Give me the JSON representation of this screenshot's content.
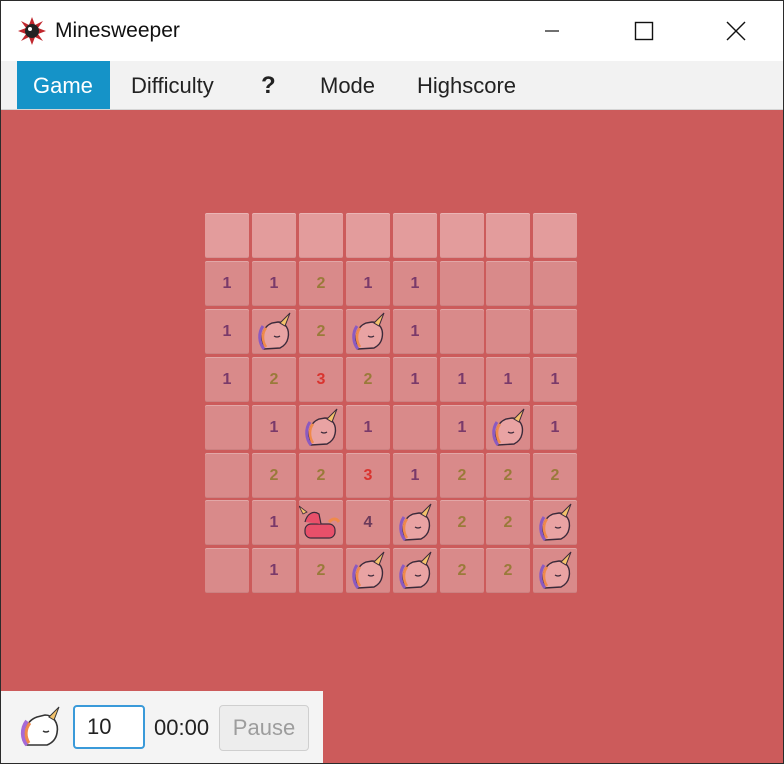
{
  "window": {
    "title": "Minesweeper",
    "icon": "mine-icon"
  },
  "menu": {
    "items": [
      {
        "label": "Game",
        "active": true
      },
      {
        "label": "Difficulty",
        "active": false
      },
      {
        "label": "?",
        "active": false
      },
      {
        "label": "Mode",
        "active": false
      },
      {
        "label": "Highscore",
        "active": false
      }
    ]
  },
  "board": {
    "rows": 8,
    "cols": 8,
    "cells": [
      [
        "",
        "",
        "",
        "",
        "",
        "",
        "",
        ""
      ],
      [
        "1",
        "1",
        "2",
        "1",
        "1",
        "",
        "",
        ""
      ],
      [
        "1",
        "U",
        "2",
        "U",
        "1",
        "",
        "",
        ""
      ],
      [
        "1",
        "2",
        "3",
        "2",
        "1",
        "1",
        "1",
        "1"
      ],
      [
        "",
        "1",
        "U",
        "1",
        "",
        "1",
        "U",
        "1"
      ],
      [
        "",
        "2",
        "2",
        "3",
        "1",
        "2",
        "2",
        "2"
      ],
      [
        "",
        "1",
        "X",
        "4",
        "U",
        "2",
        "2",
        "U"
      ],
      [
        "",
        "1",
        "2",
        "U",
        "U",
        "2",
        "2",
        "U"
      ]
    ],
    "legend": {
      "U": "unicorn-mine-icon",
      "X": "exploded-unicorn-icon"
    }
  },
  "status": {
    "mine_count": "10",
    "timer": "00:00",
    "pause_label": "Pause"
  },
  "colors": {
    "board_bg": "#cc5b5b",
    "cell": "#d98a8a",
    "menu_active": "#1593c8"
  }
}
